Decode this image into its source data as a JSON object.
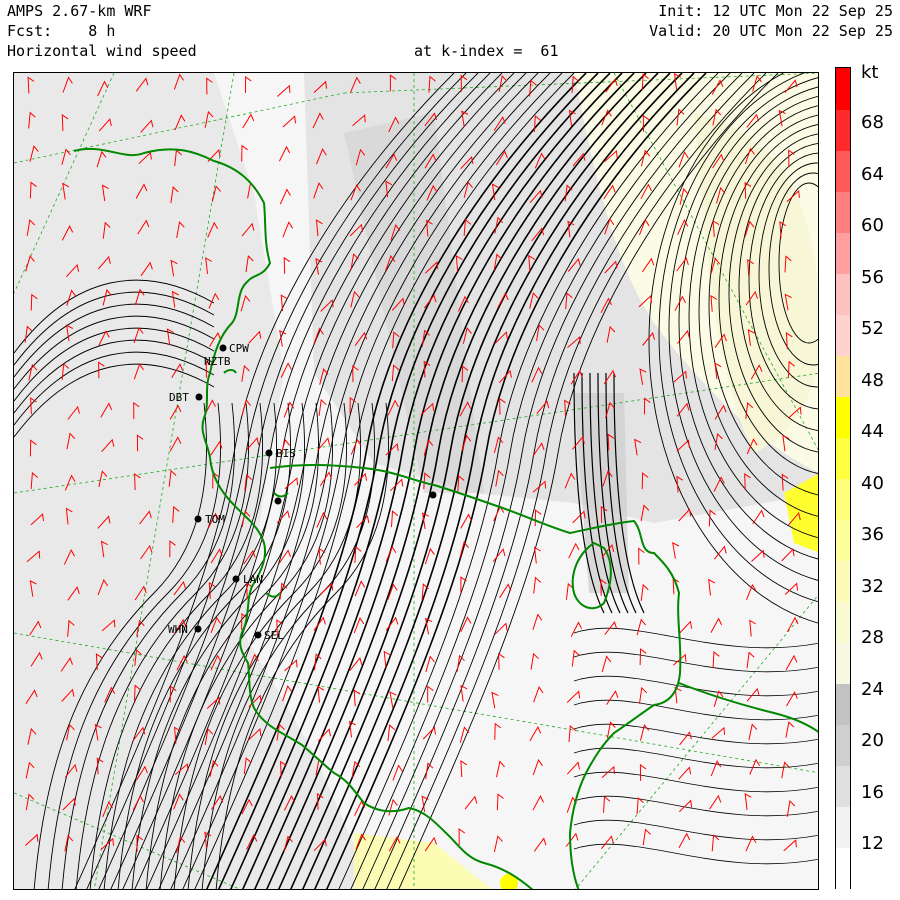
{
  "header": {
    "model": "AMPS 2.67-km WRF",
    "forecast": "Fcst:    8 h",
    "field": "Horizontal wind speed",
    "level": "at k-index =  61",
    "init": "Init: 12 UTC Mon 22 Sep 25",
    "valid": "Valid: 20 UTC Mon 22 Sep 25"
  },
  "colorbar": {
    "unit": "kt",
    "labels": [
      "68",
      "64",
      "60",
      "56",
      "52",
      "48",
      "44",
      "40",
      "36",
      "32",
      "28",
      "24",
      "20",
      "16",
      "12"
    ],
    "colors": [
      "#ffffff",
      "#f2f2f2",
      "#e0e0e0",
      "#cfcfcf",
      "#c2c2c2",
      "#f7f7e2",
      "#fafad2",
      "#fcfcb8",
      "#fdfd9a",
      "#ffff7a",
      "#ffff40",
      "#ffff00",
      "#ffe39c",
      "#ffd2cf",
      "#ffc0c0",
      "#ff9f9f",
      "#ff7f7f",
      "#ff5a5a",
      "#ff2a2a",
      "#ff0000"
    ]
  },
  "stations": [
    {
      "id": "CPW",
      "name": "CPW"
    },
    {
      "id": "NZTB",
      "name": "NZTB"
    },
    {
      "id": "DBT",
      "name": "DBT"
    },
    {
      "id": "BIS",
      "name": "BIS"
    },
    {
      "id": "TOM",
      "name": "TOM"
    },
    {
      "id": "LAN",
      "name": "LAN"
    },
    {
      "id": "WHN",
      "name": "WHN"
    },
    {
      "id": "SEL",
      "name": "SEL"
    }
  ],
  "colors": {
    "coastline": "#008800",
    "barbs": "#ff0000",
    "streamlines": "#000000",
    "gridlines": "#22aa22"
  }
}
